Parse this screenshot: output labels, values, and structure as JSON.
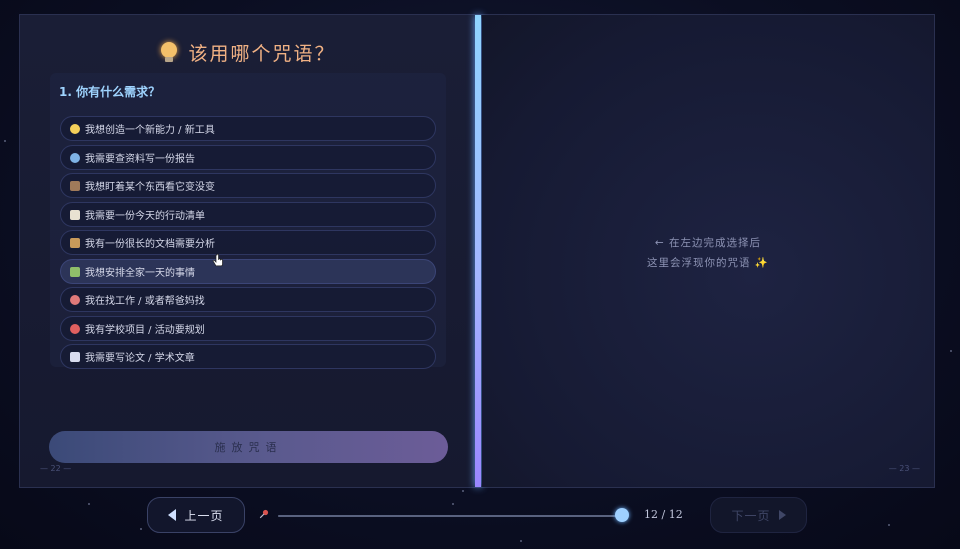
{
  "left_page": {
    "title": "该用哪个咒语？",
    "question": "1. 你有什么需求？",
    "options": [
      {
        "label": "我想创造一个新能力 / 新工具",
        "icon": "sparkles-icon",
        "color": "#f5d05a"
      },
      {
        "label": "我需要查资料写一份报告",
        "icon": "globe-icon",
        "color": "#7fb3e6"
      },
      {
        "label": "我想盯着某个东西看它变没变",
        "icon": "detective-icon",
        "color": "#a07a5a"
      },
      {
        "label": "我需要一份今天的行动清单",
        "icon": "memo-icon",
        "color": "#e8e2d2"
      },
      {
        "label": "我有一份很长的文档需要分析",
        "icon": "scroll-icon",
        "color": "#c99a5a"
      },
      {
        "label": "我想安排全家一天的事情",
        "icon": "house-icon",
        "color": "#8fbf6a"
      },
      {
        "label": "我在找工作 / 或者帮爸妈找",
        "icon": "rocket-icon",
        "color": "#e07a7a"
      },
      {
        "label": "我有学校项目 / 活动要规划",
        "icon": "target-icon",
        "color": "#e06060"
      },
      {
        "label": "我需要写论文 / 学术文章",
        "icon": "book-icon",
        "color": "#d8dcef"
      }
    ],
    "cast_button": "施放咒语",
    "page_number": "— 22 —"
  },
  "right_page": {
    "placeholder_line1": "← 在左边完成选择后",
    "placeholder_line2": "这里会浮现你的咒语 ✨",
    "page_number": "— 23 —"
  },
  "nav": {
    "prev_label": "上一页",
    "next_label": "下一页",
    "counter": "12 / 12",
    "progress": 1.0
  }
}
